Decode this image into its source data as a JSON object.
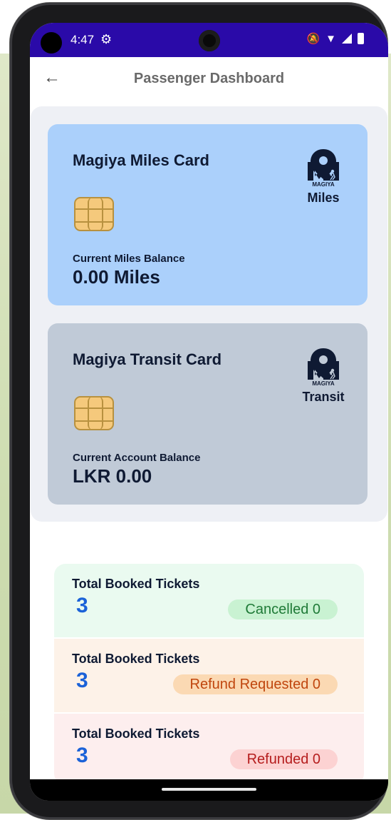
{
  "status_bar": {
    "time": "4:47",
    "settings_icon": "gear-icon",
    "icons": [
      "notifications-off-icon",
      "wifi-icon",
      "signal-icon",
      "battery-icon"
    ]
  },
  "header": {
    "title": "Passenger Dashboard",
    "back_icon": "arrow-left-icon"
  },
  "cards": {
    "miles": {
      "title": "Magiya Miles Card",
      "balance_label": "Current Miles Balance",
      "balance_value": "0.00 Miles",
      "logo_label": "Miles",
      "logo_text": "MAGIYA",
      "color": "#abd0fb"
    },
    "transit": {
      "title": "Magiya Transit Card",
      "balance_label": "Current Account Balance",
      "balance_value": "LKR 0.00",
      "logo_label": "Transit",
      "logo_text": "MAGIYA",
      "color": "#c0cad7"
    }
  },
  "tickets": [
    {
      "label": "Total Booked Tickets",
      "count": "3",
      "badge": "Cancelled 0"
    },
    {
      "label": "Total Booked Tickets",
      "count": "3",
      "badge": "Refund Requested 0"
    },
    {
      "label": "Total Booked Tickets",
      "count": "3",
      "badge": "Refunded 0"
    }
  ]
}
